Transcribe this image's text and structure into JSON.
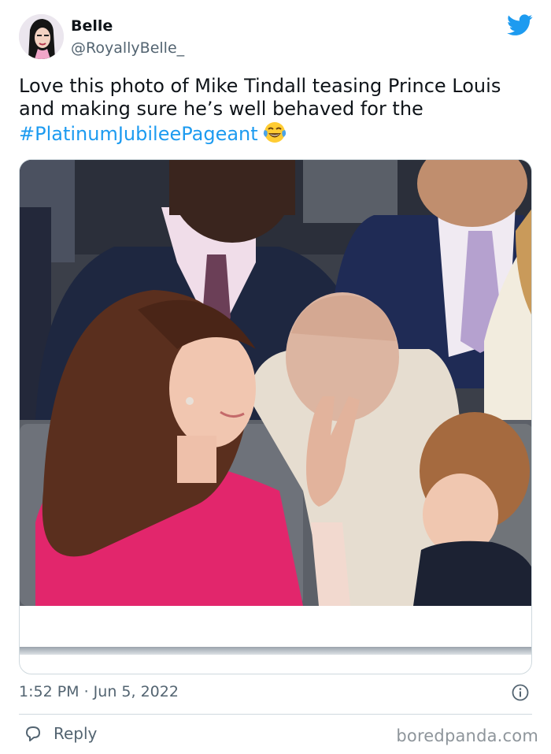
{
  "author": {
    "name": "Belle",
    "handle": "@RoyallyBelle_"
  },
  "tweet": {
    "text": "Love this photo of Mike Tindall teasing Prince Louis and making sure he’s well behaved for the",
    "hashtag": "#PlatinumJubileePageant"
  },
  "meta": {
    "timestamp": "1:52 PM · Jun 5, 2022"
  },
  "actions": {
    "reply_label": "Reply"
  },
  "watermark": "boredpanda.com",
  "colors": {
    "link": "#1d9bf0",
    "secondary_text": "#536471",
    "primary_text": "#0f1419",
    "border": "#cfd9de",
    "dress_pink": "#e2266c"
  },
  "icons": {
    "logo": "twitter-bird-icon",
    "emoji": "face-with-tears-of-joy-emoji",
    "info": "info-icon",
    "reply": "speech-bubble-icon"
  }
}
